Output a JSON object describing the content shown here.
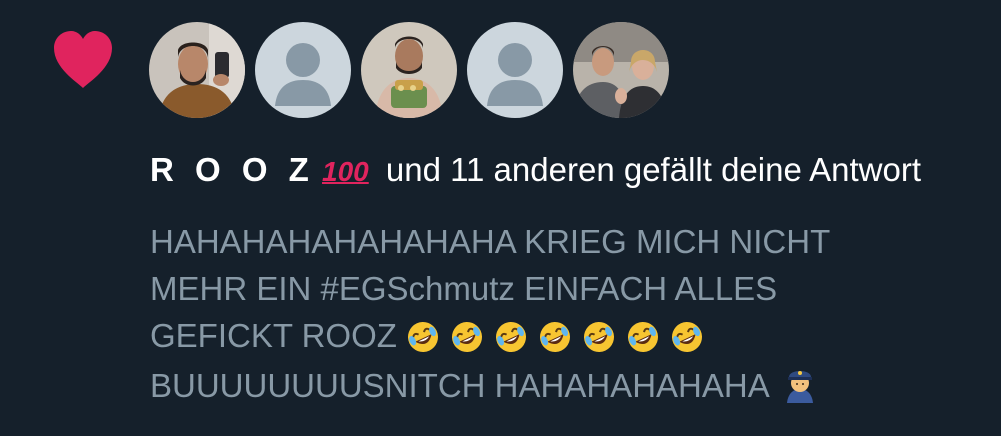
{
  "notification": {
    "icon": "heart-icon",
    "heart_color": "#e0245e",
    "background_color": "#15202b",
    "avatars": [
      {
        "kind": "photo",
        "label": "avatar-1"
      },
      {
        "kind": "default",
        "label": "avatar-2"
      },
      {
        "kind": "photo",
        "label": "avatar-3"
      },
      {
        "kind": "default",
        "label": "avatar-4"
      },
      {
        "kind": "photo",
        "label": "avatar-5"
      }
    ],
    "user_name": "R O O Z",
    "user_badge_emoji": "💯",
    "action_text": "und 11 anderen gefällt deine Antwort",
    "reply": {
      "line1": "HAHAHAHAHAHAHAHA KRIEG MICH NICHT",
      "line2": "MEHR EIN #EGSchmutz EINFACH ALLES",
      "line3_prefix": "GEFICKT ROOZ",
      "line3_emoji_count": 7,
      "line3_emoji": "🤣",
      "line4": "BUUUUUUUUSNITCH HAHAHAHAHAHA",
      "line4_emoji": "👮"
    }
  }
}
